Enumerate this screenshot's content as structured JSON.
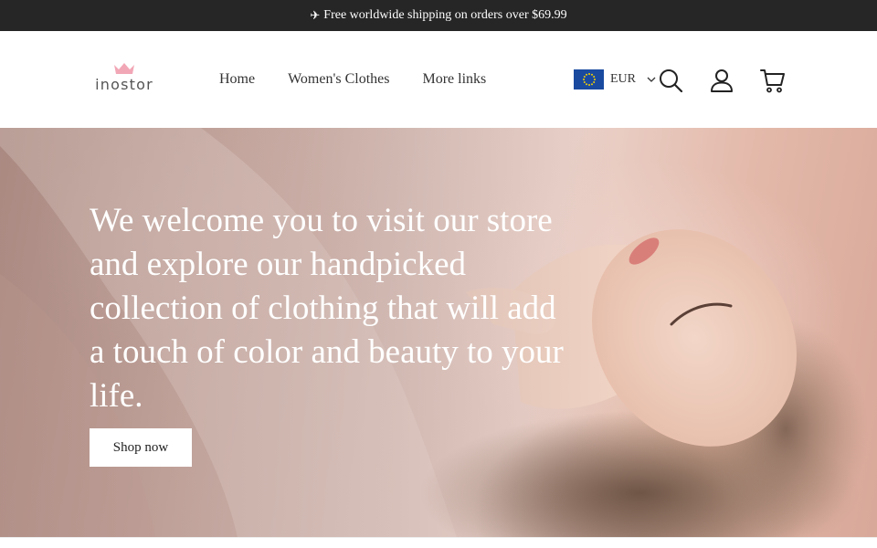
{
  "announcement": {
    "icon": "airplane-icon",
    "text": "Free worldwide shipping on orders over $69.99"
  },
  "header": {
    "logo_text": "inostor",
    "logo_icon": "crown-icon",
    "logo_color": "#f2a7b6",
    "nav": [
      {
        "label": "Home"
      },
      {
        "label": "Women's Clothes"
      },
      {
        "label": "More links"
      }
    ],
    "currency": {
      "code": "EUR",
      "flag": "eu-flag-icon"
    },
    "icons": [
      "search-icon",
      "account-icon",
      "cart-icon"
    ]
  },
  "hero": {
    "title": "We welcome you to visit our store and explore our handpicked collection of clothing that will add a touch of color and beauty to your life.",
    "button_label": "Shop now"
  },
  "colors": {
    "announcement_bg": "#262626",
    "flag_blue": "#1a4aa0",
    "flag_stars": "#f5d000"
  }
}
